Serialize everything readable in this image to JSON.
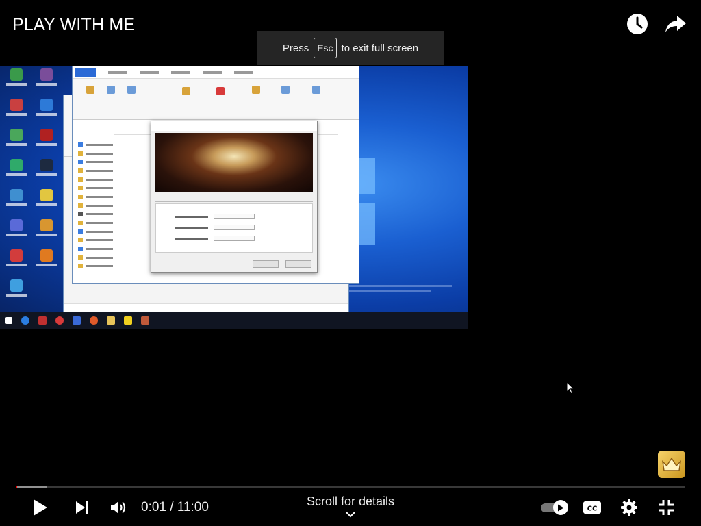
{
  "title": "PLAY WITH ME",
  "esc_toast": {
    "prefix": "Press",
    "key": "Esc",
    "suffix": "to exit full screen"
  },
  "icons": {
    "watch_later": "clock-icon",
    "share": "share-arrow-icon",
    "play": "play-icon",
    "next": "next-track-icon",
    "volume": "volume-icon",
    "chevron": "chevron-down-icon",
    "captions": "cc-icon",
    "settings": "gear-icon",
    "exit_fullscreen": "exit-fullscreen-icon",
    "channel_badge": "crown-badge-icon"
  },
  "player": {
    "current_time": "0:01",
    "separator": "/",
    "duration": "11:00",
    "played_fraction": 0.0015,
    "buffered_fraction": 0.045,
    "autoplay": true,
    "scroll_hint": "Scroll for details"
  },
  "colors": {
    "progress_played": "#ff0000",
    "background": "#000000",
    "desktop_blue": "#1a5fd1"
  }
}
